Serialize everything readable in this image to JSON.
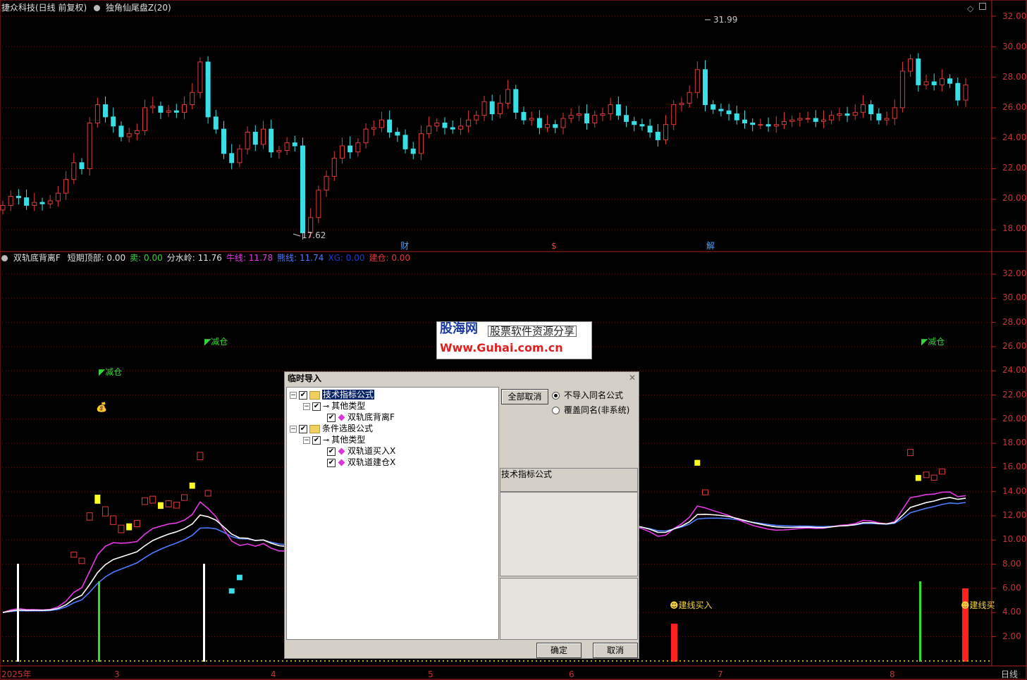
{
  "top_header": {
    "stock": "捷众科技(日线 前复权)",
    "indicator": "独角仙尾盘Z(20)"
  },
  "top_axis": [
    "32.00",
    "30.00",
    "28.00",
    "26.00",
    "24.00",
    "22.00",
    "20.00",
    "18.00"
  ],
  "top_markers": {
    "high": "31.99",
    "low": "17.62",
    "cai": "财",
    "dollar": "$",
    "jie": "解"
  },
  "bottom_header": {
    "name": "双轨底背离F",
    "items": [
      {
        "text": "短期顶部: 0.00",
        "color": "#e0e0e0"
      },
      {
        "text": "卖: 0.00",
        "color": "#36d636"
      },
      {
        "text": "分水岭: 11.76",
        "color": "#e0e0e0"
      },
      {
        "text": "牛线: 11.78",
        "color": "#e43ae4"
      },
      {
        "text": "熊线: 11.74",
        "color": "#4f7cff"
      },
      {
        "text": "XG: 0.00",
        "color": "#1e3ad6"
      },
      {
        "text": "建仓: 0.00",
        "color": "#e23a3a"
      }
    ]
  },
  "bottom_axis": [
    "32.00",
    "30.00",
    "28.00",
    "26.00",
    "24.00",
    "22.00",
    "20.00",
    "18.00",
    "16.00",
    "14.00",
    "12.00",
    "10.00",
    "8.00",
    "6.00",
    "4.00",
    "2.00"
  ],
  "bottom_labels": {
    "reduce": "减仓",
    "buy_signal": "建线买入",
    "buy_signal_short": "建线买"
  },
  "xaxis": {
    "labels": [
      "2025年",
      "3",
      "4",
      "5",
      "6",
      "7",
      "8"
    ],
    "period": "日线"
  },
  "watermark": {
    "brand": "股海网",
    "slogan": "股票软件资源分享",
    "url": "Www.Guhai.com.cn"
  },
  "dialog": {
    "title": "临时导入",
    "tree": [
      {
        "label": "技术指标公式",
        "level": 0,
        "type": "folder",
        "checked": true,
        "selected": true
      },
      {
        "label": "其他类型",
        "level": 1,
        "type": "key",
        "checked": true
      },
      {
        "label": "双轨底背离F",
        "level": 2,
        "type": "item",
        "checked": true
      },
      {
        "label": "条件选股公式",
        "level": 0,
        "type": "folder",
        "checked": true
      },
      {
        "label": "其他类型",
        "level": 1,
        "type": "key",
        "checked": true
      },
      {
        "label": "双轨道买入X",
        "level": 2,
        "type": "item",
        "checked": true
      },
      {
        "label": "双轨道建仓X",
        "level": 2,
        "type": "item",
        "checked": true
      }
    ],
    "deselect_all": "全部取消",
    "options": [
      {
        "label": "不导入同名公式",
        "selected": true
      },
      {
        "label": "覆盖同名(非系统)",
        "selected": false
      }
    ],
    "info_label": "技术指标公式",
    "ok": "确定",
    "cancel": "取消"
  }
}
